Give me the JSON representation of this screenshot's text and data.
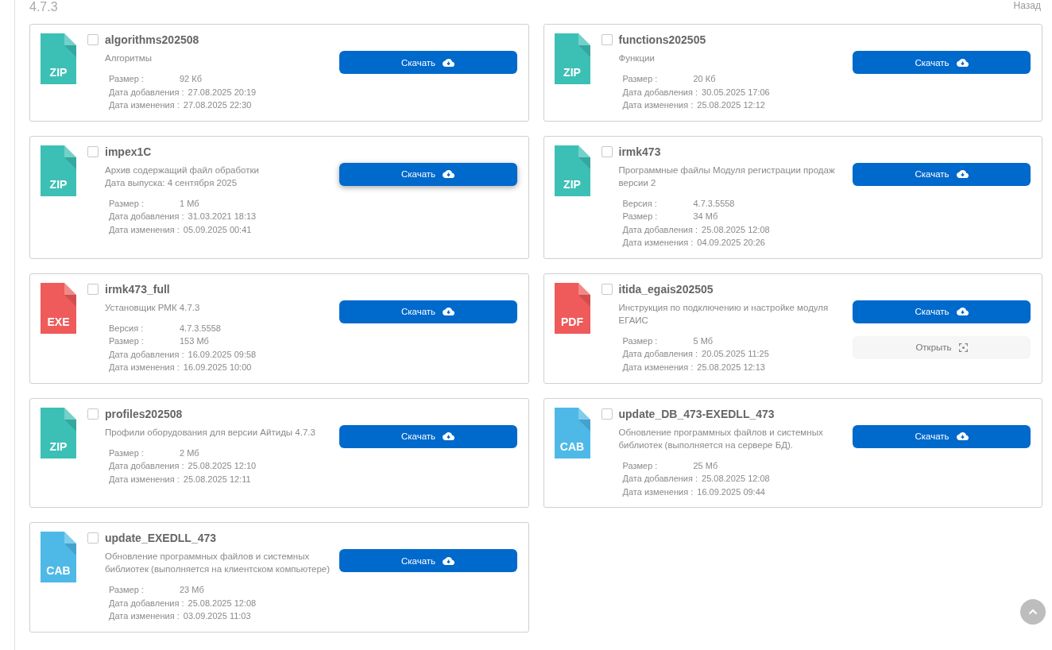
{
  "version": "4.7.3",
  "back_link": "Назад",
  "files": [
    {
      "name": "algorithms202508",
      "checked": false,
      "icon": {
        "label": "ZIP",
        "color": "#3cc0b5"
      },
      "description": "Алгоритмы",
      "meta": [
        {
          "label": "Размер :",
          "value": "92 Кб"
        },
        {
          "label": "Дата добавления :",
          "value": "27.08.2025 20:19"
        },
        {
          "label": "Дата изменения :",
          "value": "27.08.2025 22:30"
        }
      ],
      "buttons": [
        {
          "kind": "download",
          "label": "Скачать",
          "hovered": false
        }
      ]
    },
    {
      "name": "functions202505",
      "checked": false,
      "icon": {
        "label": "ZIP",
        "color": "#3cc0b5"
      },
      "description": "Функции",
      "meta": [
        {
          "label": "Размер :",
          "value": "20 Кб"
        },
        {
          "label": "Дата добавления :",
          "value": "30.05.2025 17:06"
        },
        {
          "label": "Дата изменения :",
          "value": "25.08.2025 12:12"
        }
      ],
      "buttons": [
        {
          "kind": "download",
          "label": "Скачать",
          "hovered": false
        }
      ]
    },
    {
      "name": "impex1C",
      "checked": false,
      "icon": {
        "label": "ZIP",
        "color": "#3cc0b5"
      },
      "description": "Архив содержащий файл обработки\nДата выпуска: 4 сентября 2025",
      "meta": [
        {
          "label": "Размер :",
          "value": "1 Мб"
        },
        {
          "label": "Дата добавления :",
          "value": "31.03.2021 18:13"
        },
        {
          "label": "Дата изменения :",
          "value": "05.09.2025 00:41"
        }
      ],
      "buttons": [
        {
          "kind": "download",
          "label": "Скачать",
          "hovered": true
        }
      ]
    },
    {
      "name": "irmk473",
      "checked": false,
      "icon": {
        "label": "ZIP",
        "color": "#3cc0b5"
      },
      "description": "Программные файлы Модуля регистрации продаж\nверсии 2",
      "meta": [
        {
          "label": "Версия :",
          "value": "4.7.3.5558"
        },
        {
          "label": "Размер :",
          "value": "34 Мб"
        },
        {
          "label": "Дата добавления :",
          "value": "25.08.2025 12:08"
        },
        {
          "label": "Дата изменения :",
          "value": "04.09.2025 20:26"
        }
      ],
      "buttons": [
        {
          "kind": "download",
          "label": "Скачать",
          "hovered": false
        }
      ]
    },
    {
      "name": "irmk473_full",
      "checked": false,
      "icon": {
        "label": "EXE",
        "color": "#ef5a5a"
      },
      "description": "Установщик РМК 4.7.3",
      "meta": [
        {
          "label": "Версия :",
          "value": "4.7.3.5558"
        },
        {
          "label": "Размер :",
          "value": "153 Мб"
        },
        {
          "label": "Дата добавления :",
          "value": "16.09.2025 09:58"
        },
        {
          "label": "Дата изменения :",
          "value": "16.09.2025 10:00"
        }
      ],
      "buttons": [
        {
          "kind": "download",
          "label": "Скачать",
          "hovered": false
        }
      ]
    },
    {
      "name": "itida_egais202505",
      "checked": false,
      "icon": {
        "label": "PDF",
        "color": "#ef5a5a"
      },
      "description": "Инструкция по подключению и настройке модуля\nЕГАИС",
      "meta": [
        {
          "label": "Размер :",
          "value": "5 Мб"
        },
        {
          "label": "Дата добавления :",
          "value": "20.05.2025 11:25"
        },
        {
          "label": "Дата изменения :",
          "value": "25.08.2025 12:13"
        }
      ],
      "buttons": [
        {
          "kind": "download",
          "label": "Скачать",
          "hovered": false
        },
        {
          "kind": "open",
          "label": "Открыть",
          "hovered": false
        }
      ]
    },
    {
      "name": "profiles202508",
      "checked": false,
      "icon": {
        "label": "ZIP",
        "color": "#3cc0b5"
      },
      "description": "Профили оборудования для версии Айтиды 4.7.3",
      "meta": [
        {
          "label": "Размер :",
          "value": "2 Мб"
        },
        {
          "label": "Дата добавления :",
          "value": "25.08.2025 12:10"
        },
        {
          "label": "Дата изменения :",
          "value": "25.08.2025 12:11"
        }
      ],
      "buttons": [
        {
          "kind": "download",
          "label": "Скачать",
          "hovered": false
        }
      ]
    },
    {
      "name": "update_DB_473-EXEDLL_473",
      "checked": false,
      "icon": {
        "label": "CAB",
        "color": "#4eb9e7"
      },
      "description": "Обновление программных файлов и системных\nбиблиотек (выполняется на сервере БД).",
      "meta": [
        {
          "label": "Размер :",
          "value": "25 Мб"
        },
        {
          "label": "Дата добавления :",
          "value": "25.08.2025 12:08"
        },
        {
          "label": "Дата изменения :",
          "value": "16.09.2025 09:44"
        }
      ],
      "buttons": [
        {
          "kind": "download",
          "label": "Скачать",
          "hovered": false
        }
      ]
    },
    {
      "name": "update_EXEDLL_473",
      "checked": false,
      "icon": {
        "label": "CAB",
        "color": "#4eb9e7"
      },
      "description": "Обновление программных файлов и системных\nбиблиотек (выполняется на клиентском компьютере)",
      "meta": [
        {
          "label": "Размер :",
          "value": "23 Мб"
        },
        {
          "label": "Дата добавления :",
          "value": "25.08.2025 12:08"
        },
        {
          "label": "Дата изменения :",
          "value": "03.09.2025 11:03"
        }
      ],
      "buttons": [
        {
          "kind": "download",
          "label": "Скачать",
          "hovered": false
        }
      ]
    }
  ]
}
